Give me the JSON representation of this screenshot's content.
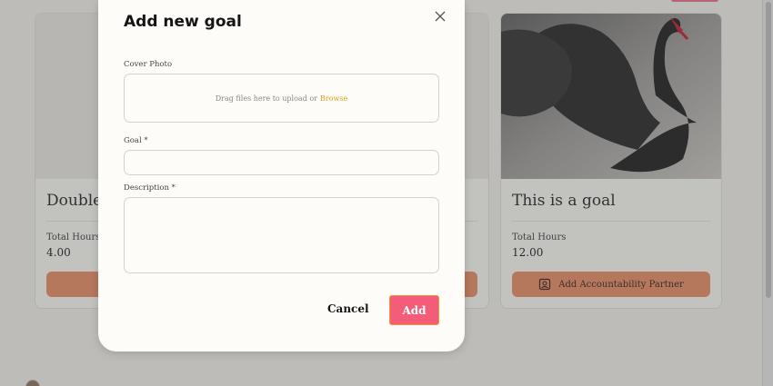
{
  "background": {
    "cards": [
      {
        "title": "Double",
        "hours_label": "Total Hours",
        "hours_value": "4.00",
        "partner_label": ""
      },
      {
        "title": "",
        "hours_label": "",
        "hours_value": "",
        "partner_label": ""
      },
      {
        "title": "This is a goal",
        "hours_label": "Total Hours",
        "hours_value": "12.00",
        "partner_label": "Add Accountability Partner"
      }
    ]
  },
  "modal": {
    "title": "Add new goal",
    "cover_label": "Cover Photo",
    "dropzone_text": "Drag files here to upload or",
    "browse_label": "Browse",
    "goal_label": "Goal *",
    "goal_value": "",
    "description_label": "Description *",
    "description_value": "",
    "cancel_label": "Cancel",
    "add_label": "Add"
  },
  "colors": {
    "accent": "#f45d7a",
    "partner_button": "#e7895e",
    "browse_link": "#d9a31a"
  }
}
